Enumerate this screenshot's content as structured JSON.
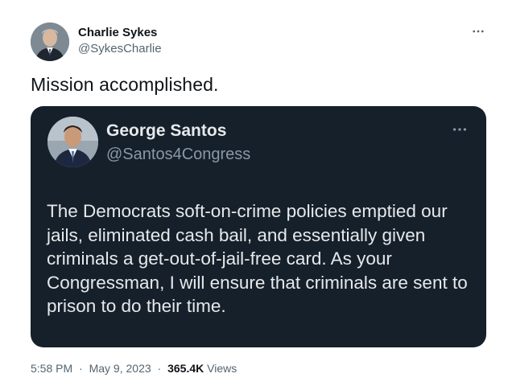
{
  "tweet": {
    "author": {
      "name": "Charlie Sykes",
      "handle": "@SykesCharlie"
    },
    "text": "Mission accomplished.",
    "more_icon": "more-horizontal-icon",
    "timestamp": "5:58 PM",
    "separator": "·",
    "date": "May 9, 2023",
    "views_count": "365.4K",
    "views_label": "Views"
  },
  "quoted_tweet": {
    "author": {
      "name": "George Santos",
      "handle": "@Santos4Congress"
    },
    "more_icon": "more-horizontal-icon",
    "text": "The Democrats soft-on-crime policies emptied our jails, eliminated cash bail, and essentially given criminals a get-out-of-jail-free card. As your Congressman, I will ensure that criminals are sent to prison to do their time.",
    "background_color": "#15202b"
  },
  "colors": {
    "text_primary": "#0f1419",
    "text_secondary": "#536471",
    "quote_text": "#e7e9ea",
    "quote_secondary": "#8b98a5"
  }
}
